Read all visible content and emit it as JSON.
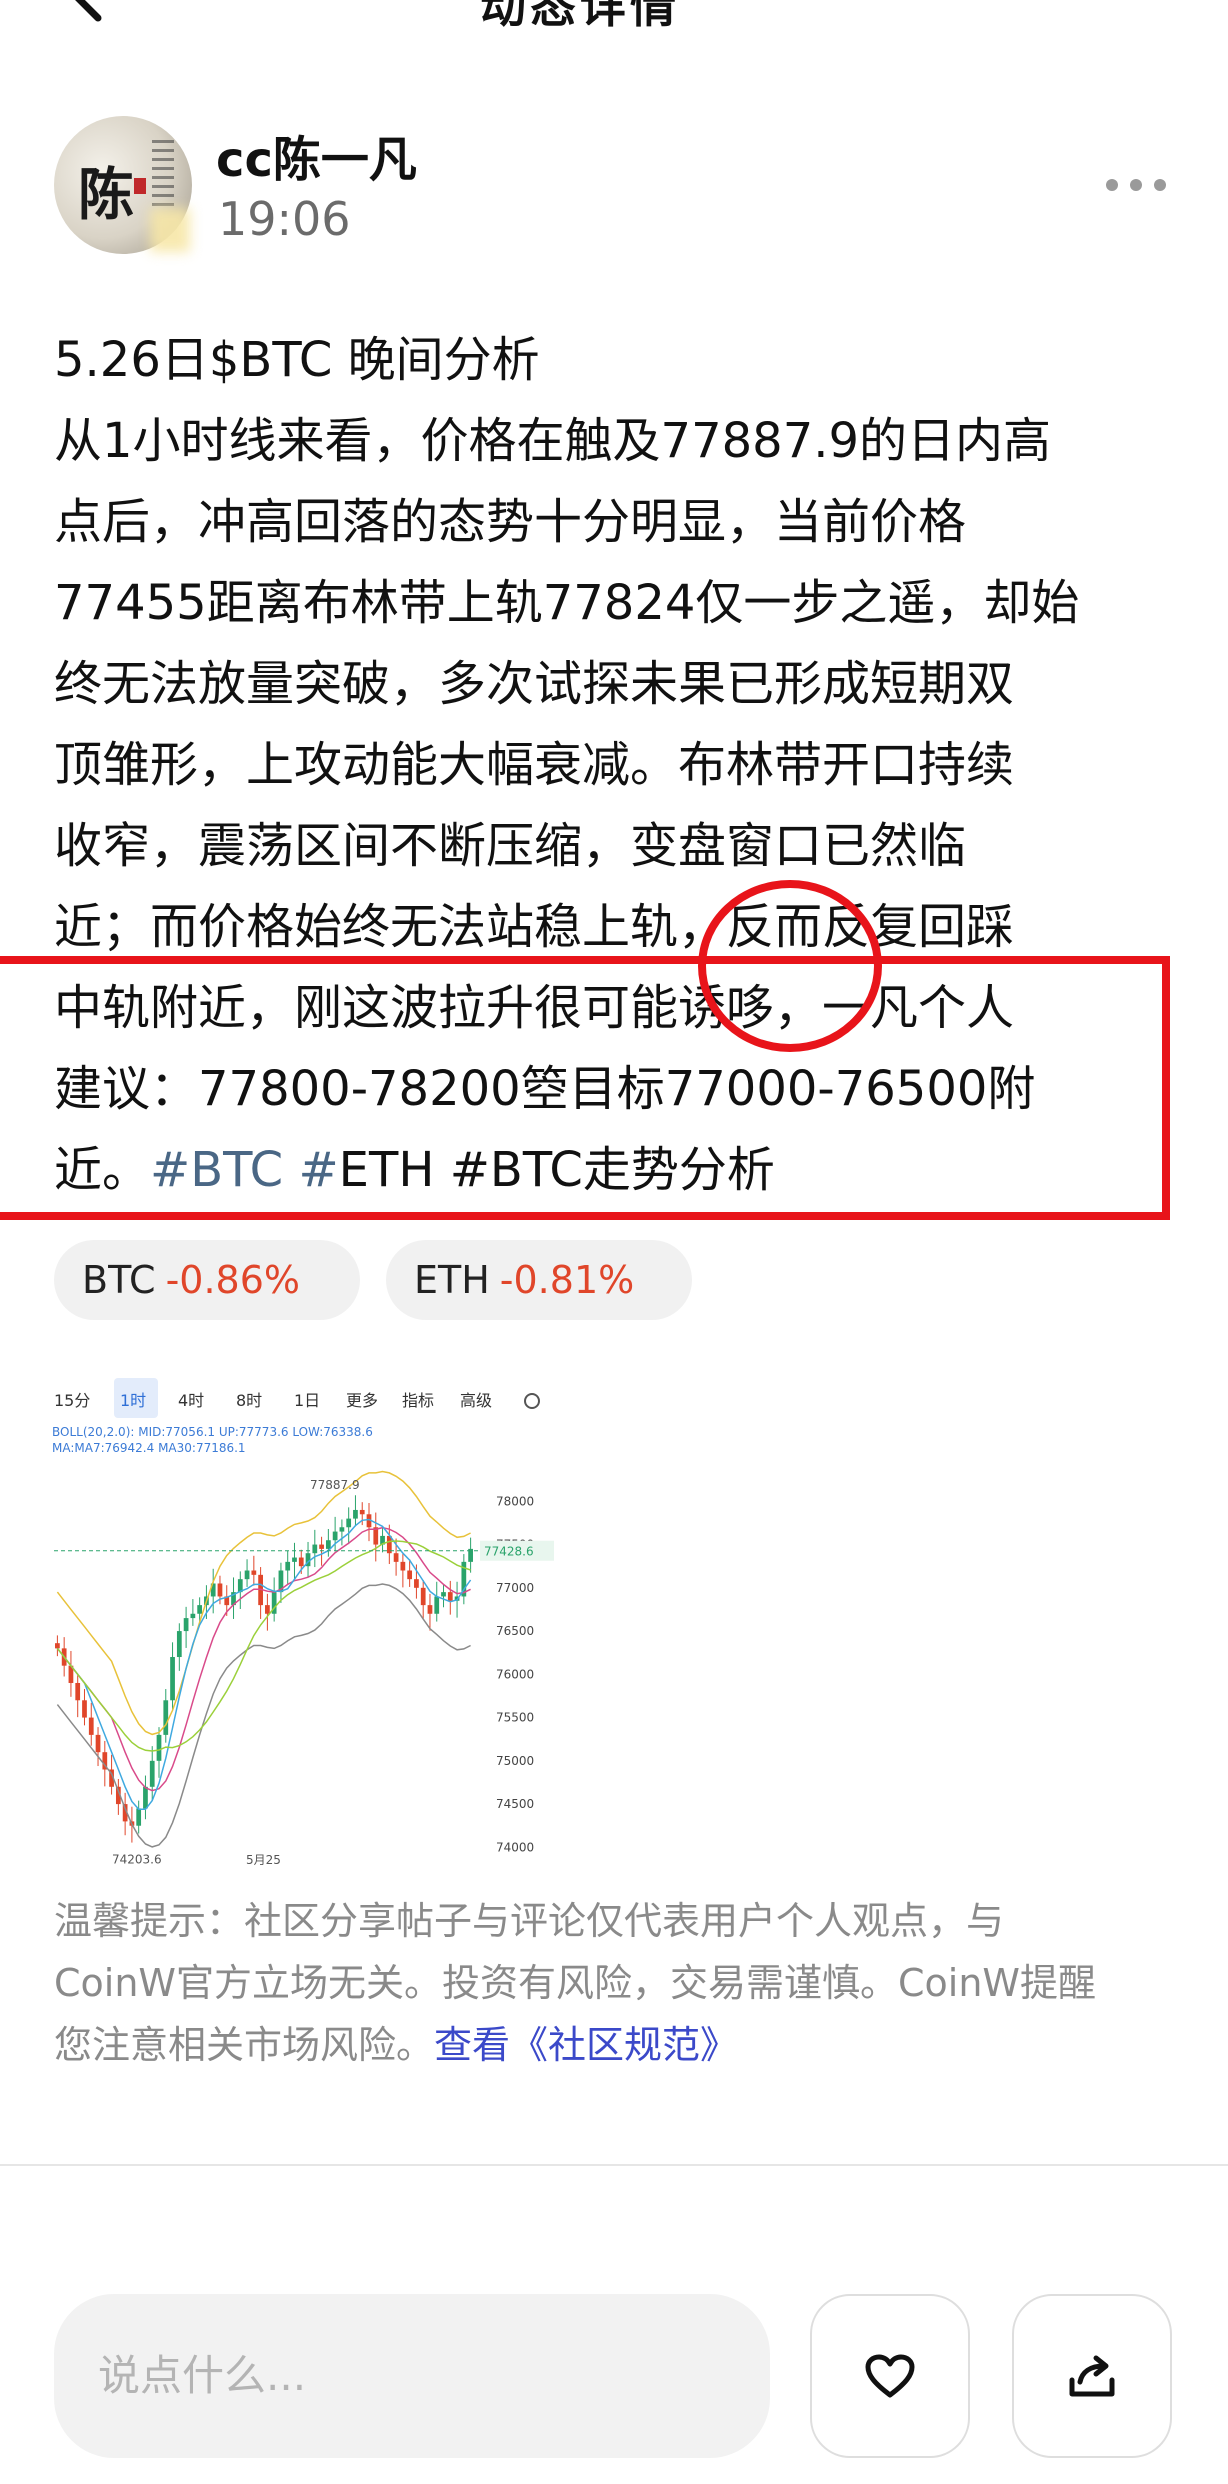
{
  "nav": {
    "title": "动态详情"
  },
  "author": {
    "name": "cc陈一凡",
    "time": "19:06",
    "avatar_char": "陈"
  },
  "post": {
    "lines": [
      "5.26日$BTC 晚间分析",
      "从1小时线来看，价格在触及77887.9的日内高",
      "点后，冲高回落的态势十分明显，当前价格",
      "77455距离布林带上轨77824仅一步之遥，却始",
      "终无法放量突破，多次试探未果已形成短期双",
      "顶雏形，上攻动能大幅衰减。布林带开口持续",
      "收窄，震荡区间不断压缩，变盘窗口已然临",
      "近；而价格始终无法站稳上轨，反而反复回踩",
      "中轨附近，刚这波拉升很可能诱哆，一凡个人",
      "建议：77800-78200箜目标77000-76500附"
    ],
    "last_line_prefix": "近。",
    "hashtags": [
      "#BTC",
      "#ETH",
      "#BTC走势分析"
    ]
  },
  "tickers": [
    {
      "symbol": "BTC",
      "change": "-0.86%"
    },
    {
      "symbol": "ETH",
      "change": "-0.81%"
    }
  ],
  "chart": {
    "tabs": [
      "15分",
      "1时",
      "4时",
      "8时",
      "1日",
      "更多",
      "指标",
      "高级"
    ],
    "active_tab": "1时",
    "boll_legend": "BOLL(20,2.0): MID:77056.1 UP:77773.6 LOW:76338.6",
    "ma_legend": "MA:MA7:76942.4 MA30:77186.1",
    "high_label": "77887.9",
    "low_label": "74203.6",
    "price_tag": "77428.6",
    "date_label": "5月25",
    "y_ticks": [
      "78000",
      "77500",
      "77000",
      "76500",
      "76000",
      "75500",
      "75000",
      "74500",
      "74000"
    ],
    "colors": {
      "up": "#2aa36b",
      "down": "#e0462a",
      "boll_up": "#e8c23a",
      "boll_mid": "#d94a8a",
      "boll_low": "#8a8a8a",
      "ma7": "#3fa9e0",
      "ma30": "#9bd03a"
    }
  },
  "disclaimer": {
    "lines": [
      "温馨提示：社区分享帖子与评论仅代表用户个人观点，与",
      "CoinW官方立场无关。投资有风险，交易需谨慎。CoinW提醒",
      "您注意相关市场风险。"
    ],
    "link": "查看《社区规范》"
  },
  "bottom": {
    "comment_placeholder": "说点什么..."
  },
  "icons": {
    "back": "back-icon",
    "more": "more-icon",
    "like": "heart-icon",
    "share": "share-icon"
  }
}
